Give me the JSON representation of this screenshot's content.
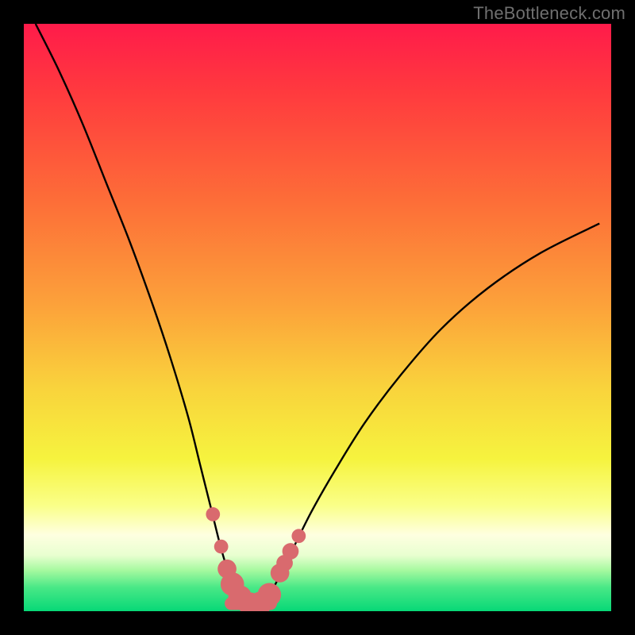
{
  "watermark": "TheBottleneck.com",
  "colors": {
    "page_bg": "#000000",
    "watermark": "#6f6f6f",
    "curve": "#000000",
    "marker_fill": "#d96a6e",
    "marker_stroke": "#c45a5f",
    "gradient_stops": [
      {
        "offset": 0.0,
        "color": "#ff1b4a"
      },
      {
        "offset": 0.12,
        "color": "#ff3b3e"
      },
      {
        "offset": 0.3,
        "color": "#fd6d38"
      },
      {
        "offset": 0.48,
        "color": "#fca23a"
      },
      {
        "offset": 0.62,
        "color": "#f9d33c"
      },
      {
        "offset": 0.74,
        "color": "#f6f33e"
      },
      {
        "offset": 0.82,
        "color": "#faff88"
      },
      {
        "offset": 0.87,
        "color": "#feffe0"
      },
      {
        "offset": 0.905,
        "color": "#e8ffd0"
      },
      {
        "offset": 0.93,
        "color": "#a7f9a0"
      },
      {
        "offset": 0.96,
        "color": "#48e886"
      },
      {
        "offset": 1.0,
        "color": "#07d877"
      }
    ]
  },
  "chart_data": {
    "type": "line",
    "title": "",
    "xlabel": "",
    "ylabel": "",
    "xlim": [
      0,
      100
    ],
    "ylim": [
      0,
      100
    ],
    "annotations": [],
    "series": [
      {
        "name": "bottleneck-curve",
        "x": [
          2,
          6,
          10,
          14,
          18,
          22,
          25,
          28,
          30,
          32,
          33.5,
          35,
          36.2,
          37,
          38,
          39,
          40,
          41,
          42.5,
          44,
          46,
          49,
          53,
          58,
          64,
          71,
          79,
          88,
          98
        ],
        "y": [
          100,
          92,
          83,
          73,
          63,
          52,
          43,
          33,
          25,
          17,
          11,
          6,
          3,
          1.5,
          1,
          1,
          1.2,
          2,
          4,
          7,
          11,
          17,
          24,
          32,
          40,
          48,
          55,
          61,
          66
        ]
      }
    ],
    "markers": [
      {
        "x": 32.2,
        "y": 16.5,
        "r": 1.2
      },
      {
        "x": 33.6,
        "y": 11.0,
        "r": 1.2
      },
      {
        "x": 34.6,
        "y": 7.2,
        "r": 1.6
      },
      {
        "x": 35.5,
        "y": 4.6,
        "r": 2.0
      },
      {
        "x": 36.8,
        "y": 2.4,
        "r": 2.0
      },
      {
        "x": 38.5,
        "y": 1.2,
        "r": 2.0
      },
      {
        "x": 40.2,
        "y": 1.3,
        "r": 2.0
      },
      {
        "x": 41.8,
        "y": 2.8,
        "r": 2.0
      },
      {
        "x": 43.6,
        "y": 6.5,
        "r": 1.6
      },
      {
        "x": 44.4,
        "y": 8.2,
        "r": 1.4
      },
      {
        "x": 45.4,
        "y": 10.2,
        "r": 1.4
      },
      {
        "x": 46.8,
        "y": 12.8,
        "r": 1.2
      }
    ],
    "bottom_segment": {
      "x_start": 35.3,
      "x_end": 42.0,
      "y": 1.3,
      "thickness": 2.2
    }
  }
}
